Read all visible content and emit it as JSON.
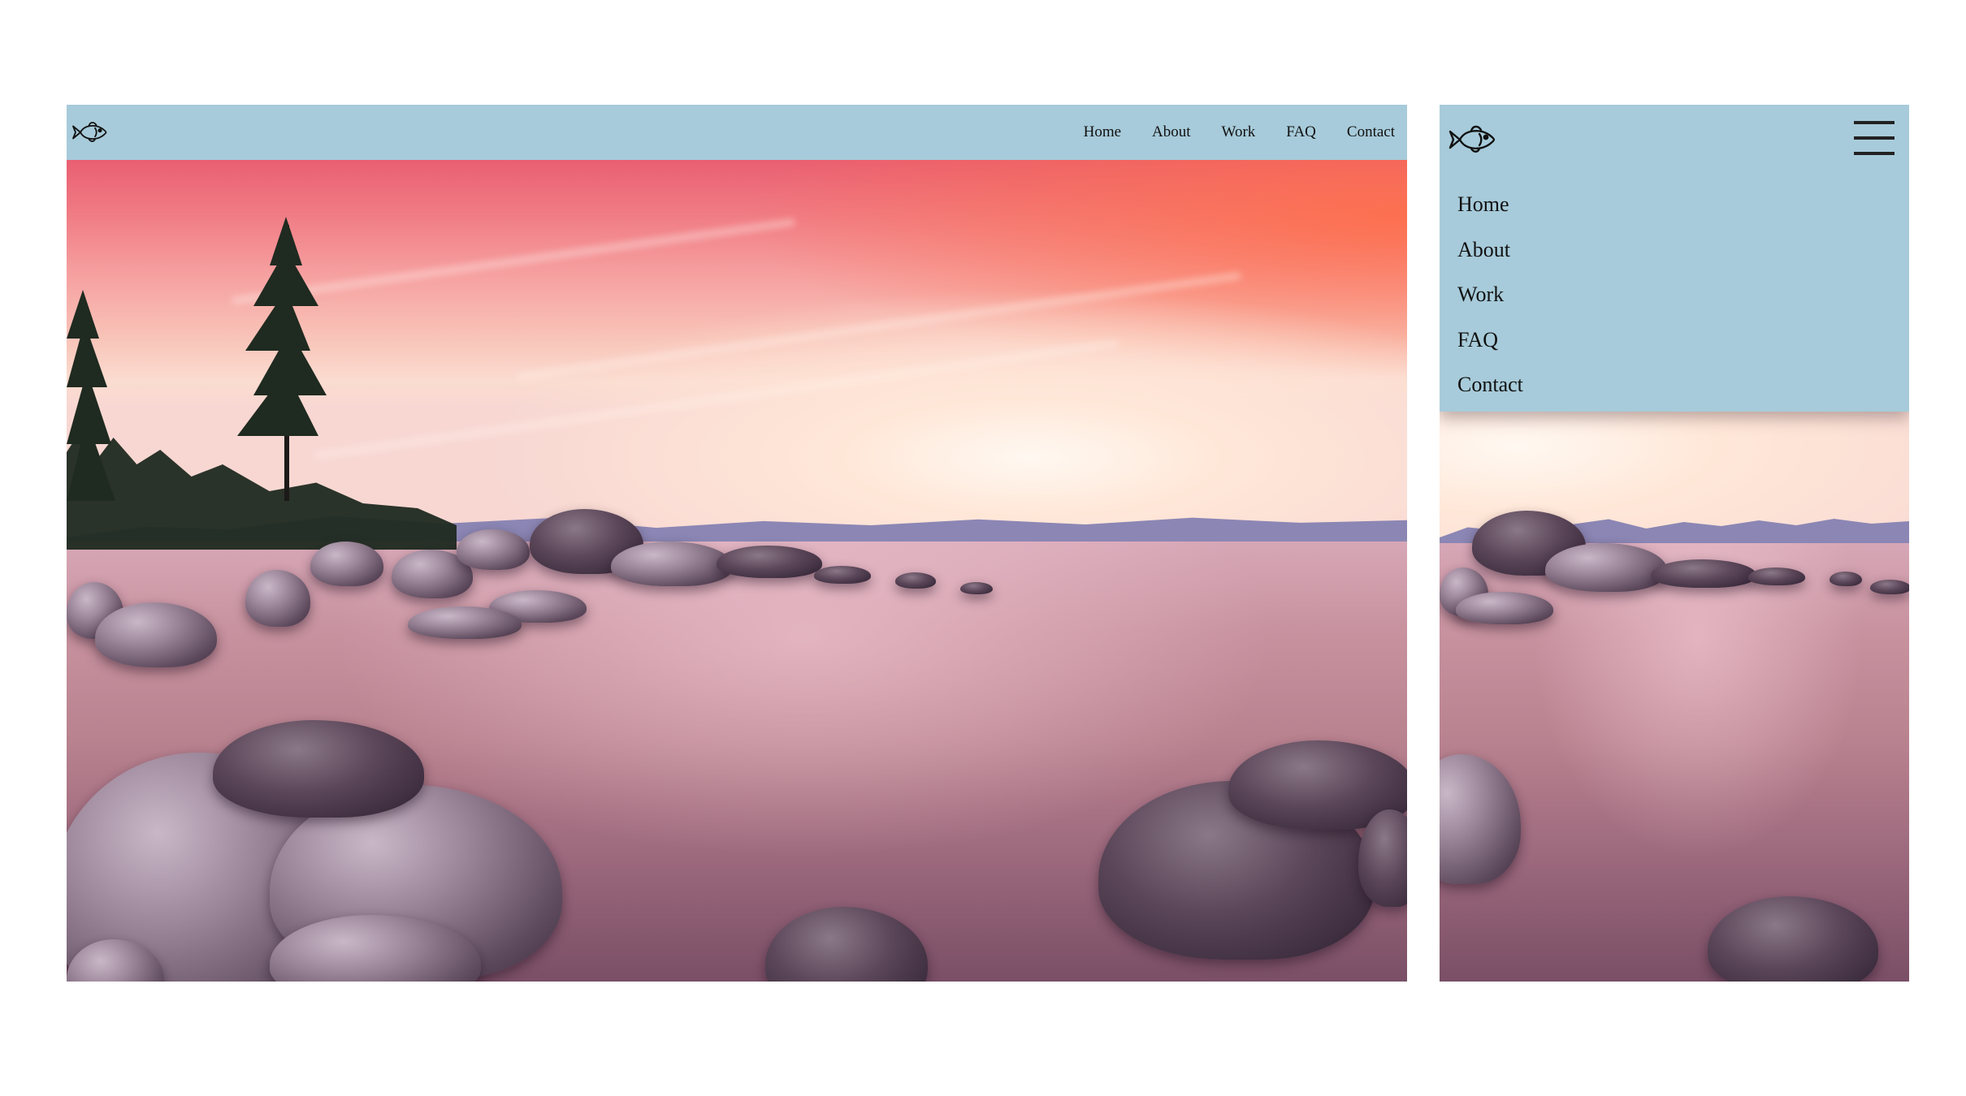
{
  "desktop": {
    "logo_icon": "fish-icon",
    "nav": {
      "background": "#a7cbda",
      "links": [
        "Home",
        "About",
        "Work",
        "FAQ",
        "Contact"
      ]
    },
    "hero_image": "lake-sunset-rocks"
  },
  "mobile": {
    "logo_icon": "fish-icon",
    "menu_icon": "hamburger-menu-icon",
    "menu_open": true,
    "nav": {
      "background": "#a7cbda",
      "links": [
        "Home",
        "About",
        "Work",
        "FAQ",
        "Contact"
      ]
    },
    "hero_image": "lake-sunset-rocks"
  }
}
